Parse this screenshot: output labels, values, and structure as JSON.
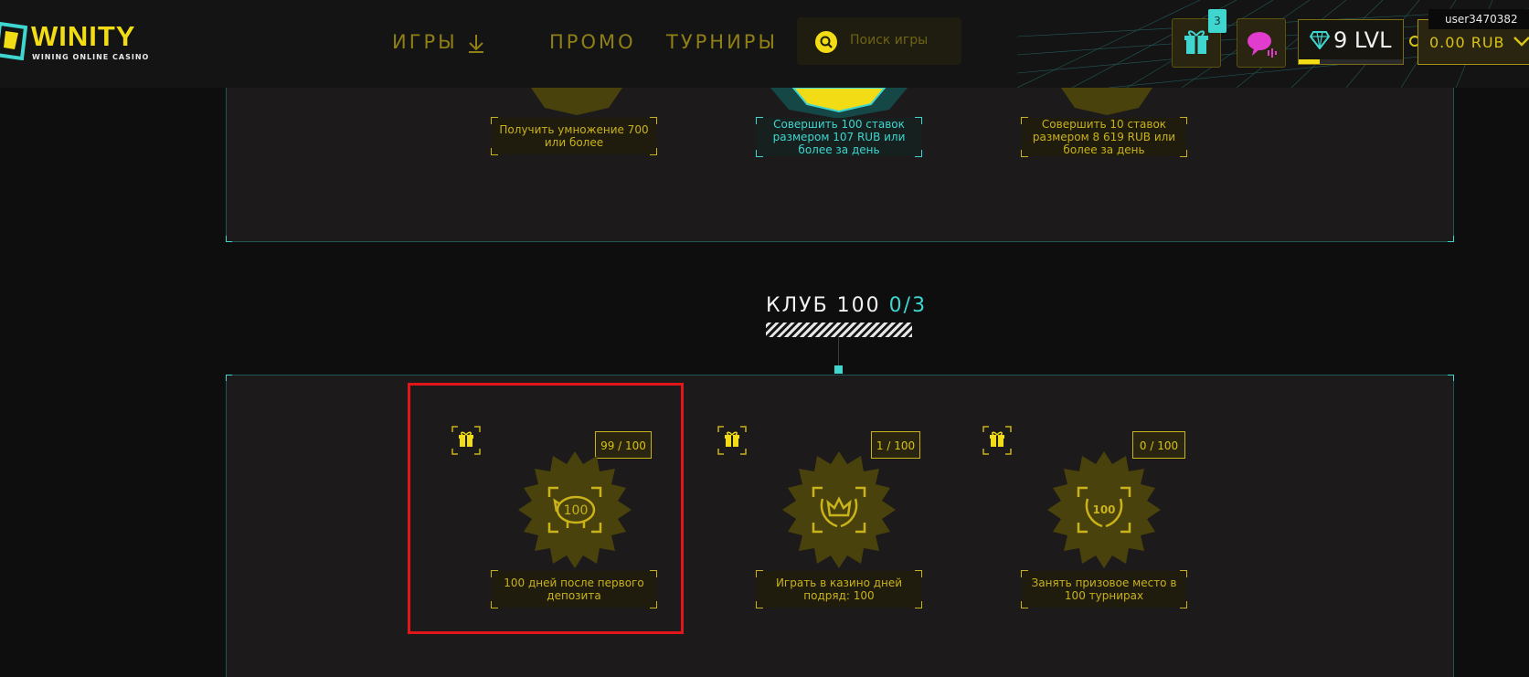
{
  "header": {
    "logo": {
      "name": "WINITY",
      "tagline": "WINING ONLINE CASINO"
    },
    "nav": [
      {
        "label": "ИГРЫ",
        "icon": "download-arrow-icon"
      },
      {
        "label": "ПРОМО"
      },
      {
        "label": "ТУРНИРЫ"
      }
    ],
    "search": {
      "placeholder": "Поиск игры",
      "icon": "search-icon"
    },
    "gifts_badge": "3",
    "level": {
      "value": "9",
      "unit": "LVL",
      "progress": 0.2
    },
    "balance": "0.00 RUB",
    "username": "user3470382"
  },
  "top_section": {
    "tasks": [
      {
        "description": "Получить умножение 700 или более",
        "style": "gold"
      },
      {
        "description": "Совершить 100 ставок размером 107 RUB или более за день",
        "style": "cyan"
      },
      {
        "description": "Совершить 10 ставок размером 8 619 RUB или более за день",
        "style": "gold"
      }
    ]
  },
  "club": {
    "title": "КЛУБ 100",
    "count": "0/3",
    "tasks": [
      {
        "progress": "99 / 100",
        "description": "100 дней после первого депозита",
        "icon": "piggy-bank-100-icon",
        "highlighted": true
      },
      {
        "progress": "1 / 100",
        "description": "Играть в казино дней подряд: 100",
        "icon": "crown-laurel-icon",
        "highlighted": false
      },
      {
        "progress": "0 / 100",
        "description": "Занять призовое место в 100 турнирах",
        "icon": "laurel-100-icon",
        "highlighted": false
      }
    ]
  },
  "colors": {
    "accent_gold": "#f2dc16",
    "accent_cyan": "#3fd6d0",
    "highlight_red": "#e0161b",
    "background": "#0e0e0e"
  }
}
